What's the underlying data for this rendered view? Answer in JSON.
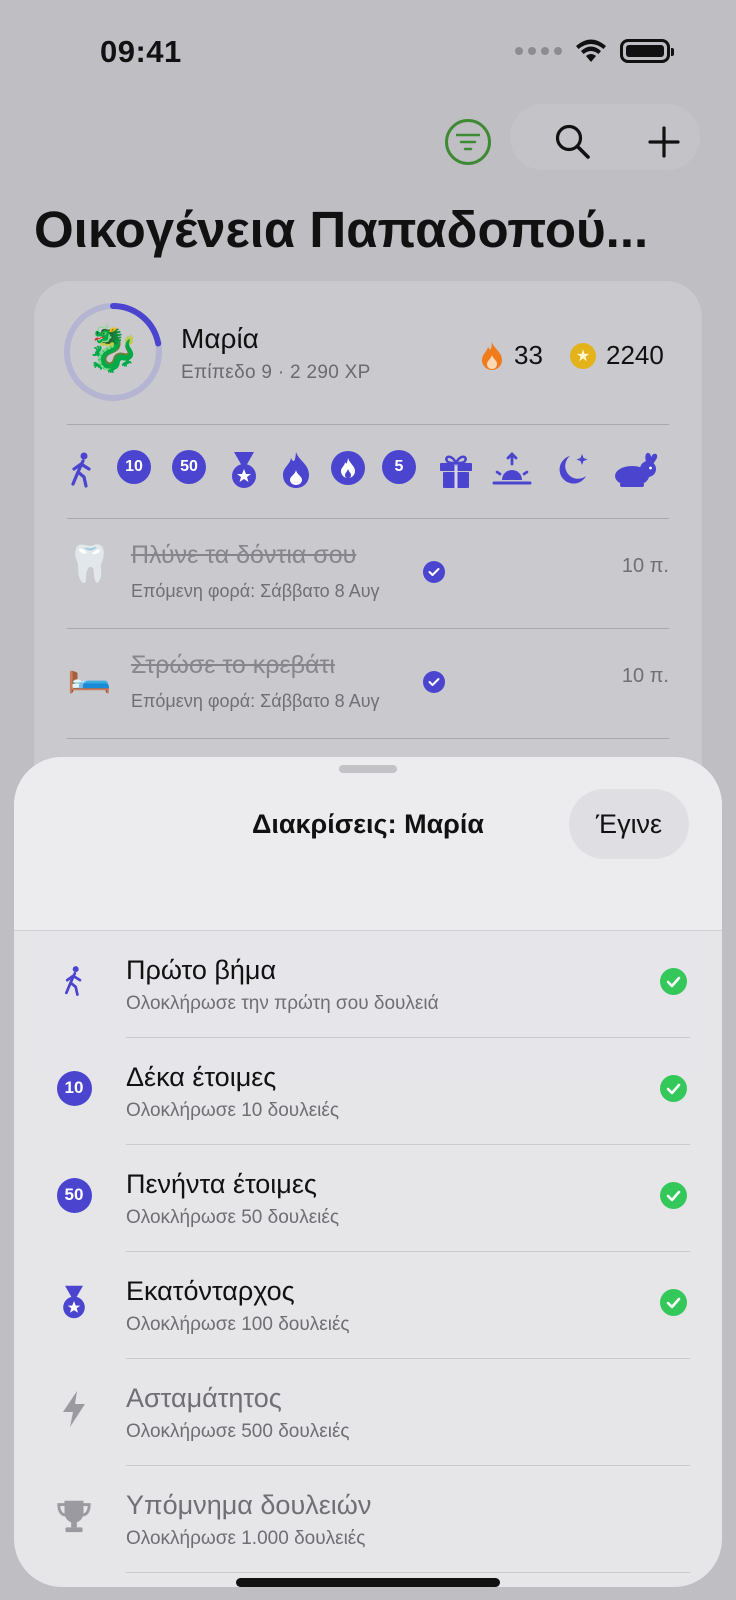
{
  "status_bar": {
    "time": "09:41"
  },
  "header": {
    "title": "Οικογένεια Παπαδοπού..."
  },
  "member": {
    "name": "Μαρία",
    "subtitle": "Επίπεδο 9 · 2 290 XP",
    "avatar_emoji": "🐉",
    "streak": "33",
    "coins": "2240",
    "level_progress": 0.22
  },
  "badges_row": [
    "walk-icon",
    "10",
    "50",
    "medal-icon",
    "flame-icon",
    "flame-icon",
    "5",
    "gift-icon",
    "sunrise-icon",
    "moon-icon",
    "rabbit-icon"
  ],
  "tasks": [
    {
      "emoji": "🦷",
      "title": "Πλύνε τα δόντια σου",
      "subtitle": "Επόμενη φορά: Σάββατο 8 Αυγ",
      "points": "10 π."
    },
    {
      "emoji": "🛏️",
      "title": "Στρώσε το κρεβάτι",
      "subtitle": "Επόμενη φορά: Σάββατο 8 Αυγ",
      "points": "10 π."
    }
  ],
  "sheet": {
    "title": "Διακρίσεις: Μαρία",
    "done_label": "Έγινε",
    "items": [
      {
        "icon": "walk-icon",
        "title": "Πρώτο βήμα",
        "subtitle": "Ολοκλήρωσε την πρώτη σου δουλειά",
        "earned": true
      },
      {
        "icon": "10",
        "title": "Δέκα έτοιμες",
        "subtitle": "Ολοκλήρωσε 10 δουλειές",
        "earned": true
      },
      {
        "icon": "50",
        "title": "Πενήντα έτοιμες",
        "subtitle": "Ολοκλήρωσε 50 δουλειές",
        "earned": true
      },
      {
        "icon": "medal-icon",
        "title": "Εκατόνταρχος",
        "subtitle": "Ολοκλήρωσε 100 δουλειές",
        "earned": true
      },
      {
        "icon": "bolt-icon",
        "title": "Ασταμάτητος",
        "subtitle": "Ολοκλήρωσε 500 δουλειές",
        "earned": false
      },
      {
        "icon": "trophy-icon",
        "title": "Υπόμνημα δουλειών",
        "subtitle": "Ολοκλήρωσε 1.000 δουλειές",
        "earned": false
      }
    ]
  },
  "colors": {
    "accent": "#4a44cf",
    "success": "#34c759",
    "filter": "#3f8a34",
    "streak": "#f07a1c",
    "coin": "#e4b21b"
  }
}
